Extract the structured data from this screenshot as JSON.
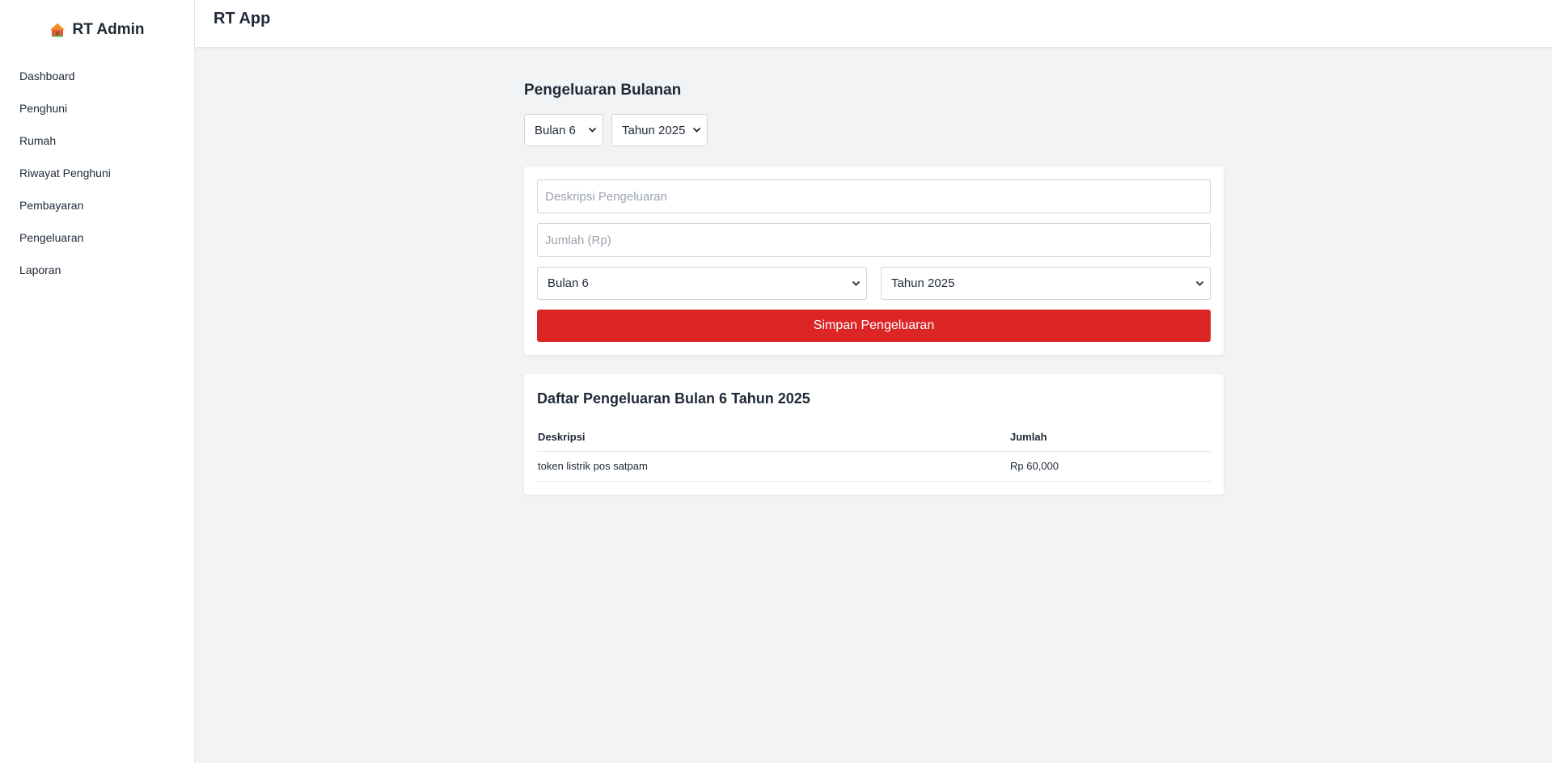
{
  "sidebar": {
    "brand": "RT Admin",
    "brand_icon": "house-icon",
    "items": [
      {
        "label": "Dashboard"
      },
      {
        "label": "Penghuni"
      },
      {
        "label": "Rumah"
      },
      {
        "label": "Riwayat Penghuni"
      },
      {
        "label": "Pembayaran"
      },
      {
        "label": "Pengeluaran"
      },
      {
        "label": "Laporan"
      }
    ]
  },
  "topbar": {
    "title": "RT App"
  },
  "page": {
    "title": "Pengeluaran Bulanan",
    "filter_month": "Bulan 6",
    "filter_year": "Tahun 2025"
  },
  "form": {
    "description_placeholder": "Deskripsi Pengeluaran",
    "amount_placeholder": "Jumlah (Rp)",
    "month": "Bulan 6",
    "year": "Tahun 2025",
    "submit_label": "Simpan Pengeluaran"
  },
  "list": {
    "title": "Daftar Pengeluaran Bulan 6 Tahun 2025",
    "columns": [
      "Deskripsi",
      "Jumlah"
    ],
    "rows": [
      {
        "description": "token listrik pos satpam",
        "amount": "Rp 60,000"
      }
    ]
  },
  "colors": {
    "accent_red": "#dc2626",
    "background": "#f2f3f5",
    "surface": "#ffffff"
  }
}
